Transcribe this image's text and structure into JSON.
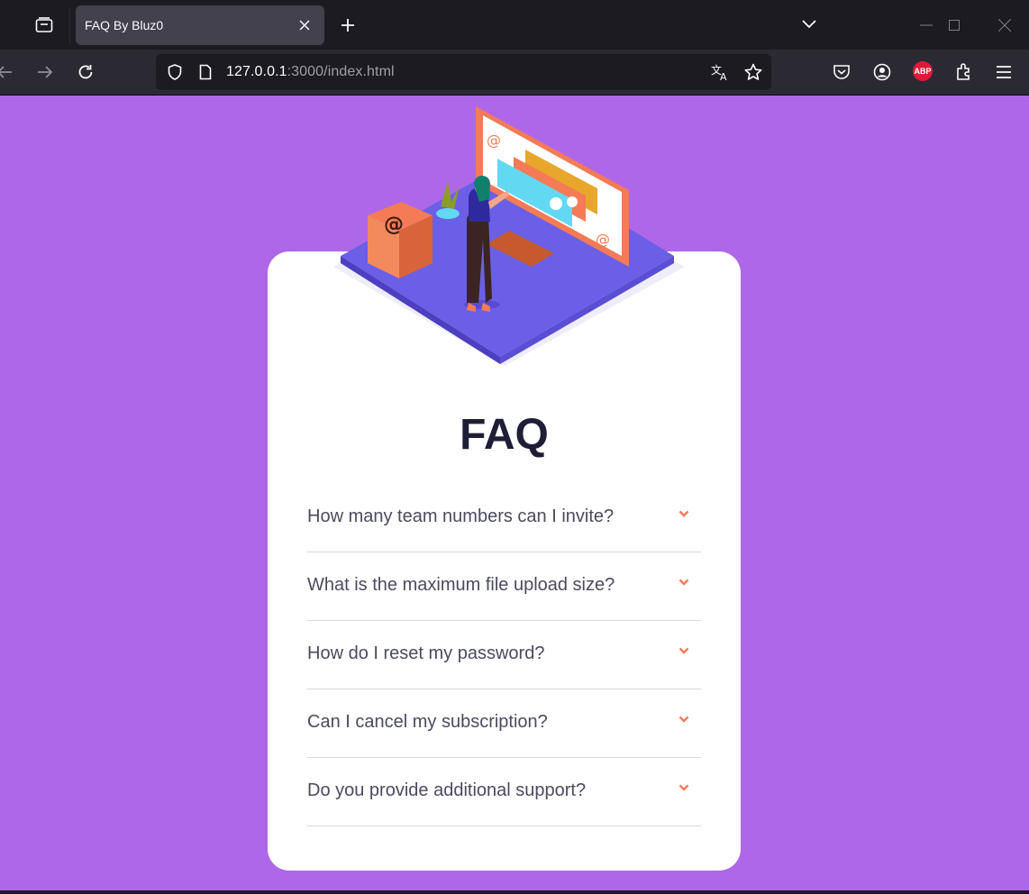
{
  "browser": {
    "tab_title": "FAQ By Bluz0",
    "url_host": "127.0.0.1",
    "url_rest": ":3000/index.html",
    "abp_label": "ABP"
  },
  "page": {
    "background": "#af67e9",
    "title": "FAQ",
    "accent": "#f47b56",
    "questions": [
      "How many team numbers can I invite?",
      "What is the maximum file upload size?",
      "How do I reset my password?",
      "Can I cancel my subscription?",
      "Do you provide additional support?"
    ]
  }
}
